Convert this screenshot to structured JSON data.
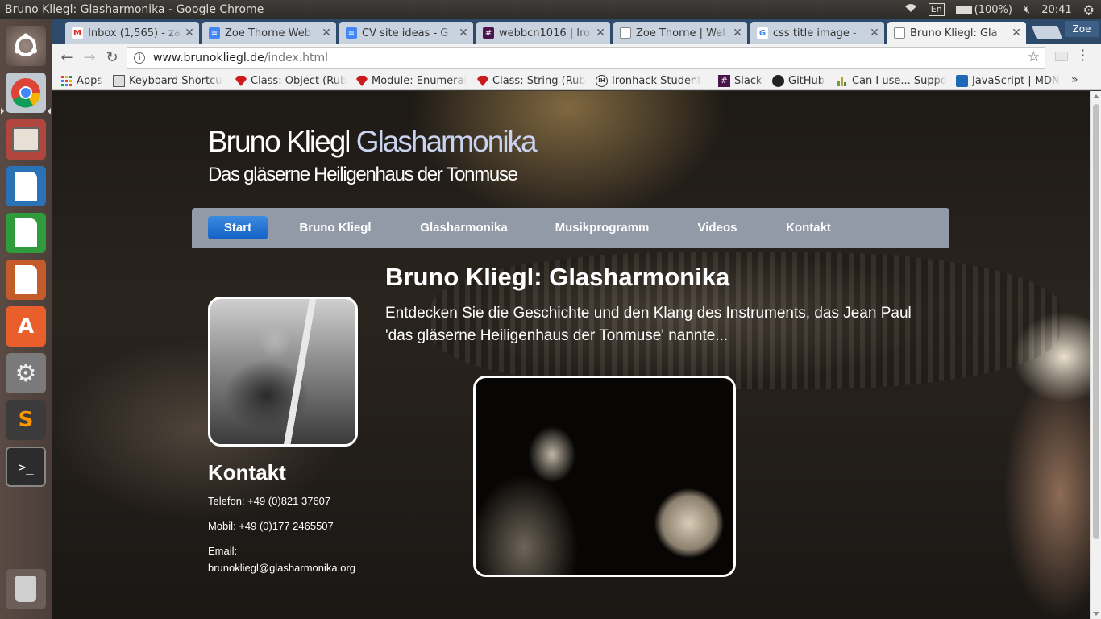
{
  "os_panel": {
    "window_title": "Bruno Kliegl: Glasharmonika - Google Chrome",
    "keyboard": "En",
    "battery": "(100%)",
    "time": "20:41"
  },
  "launcher": {
    "apps": [
      "Ubuntu Dash",
      "Chromium Browser",
      "Files",
      "LibreOffice Writer",
      "LibreOffice Calc",
      "LibreOffice Impress",
      "Ubuntu Software",
      "System Settings",
      "Sublime Text",
      "Terminal",
      "Trash"
    ]
  },
  "browser": {
    "tabs": [
      {
        "label": "Inbox (1,565) - za",
        "icon": "gmail-icon"
      },
      {
        "label": "Zoe Thorne Web",
        "icon": "docs-icon"
      },
      {
        "label": "CV site ideas - G",
        "icon": "docs-icon"
      },
      {
        "label": "webbcn1016 | Iro",
        "icon": "slack-icon"
      },
      {
        "label": "Zoe Thorne | Wel",
        "icon": "page-icon"
      },
      {
        "label": "css title image -",
        "icon": "google-icon"
      },
      {
        "label": "Bruno Kliegl: Gla",
        "icon": "page-icon"
      }
    ],
    "profile": "Zoe",
    "url_host": "www.brunokliegl.de",
    "url_path": "/index.html",
    "bookmarks": [
      {
        "label": "Apps",
        "icon": "apps-grid-icon"
      },
      {
        "label": "Keyboard Shortcu",
        "icon": "keyboard-icon"
      },
      {
        "label": "Class: Object (Rub",
        "icon": "ruby-icon"
      },
      {
        "label": "Module: Enumeral",
        "icon": "ruby-icon"
      },
      {
        "label": "Class: String (Rub",
        "icon": "ruby-icon"
      },
      {
        "label": "Ironhack Student",
        "icon": "ironhack-icon"
      },
      {
        "label": "Slack",
        "icon": "slack-icon"
      },
      {
        "label": "GitHub",
        "icon": "github-icon"
      },
      {
        "label": "Can I use... Suppo",
        "icon": "caniuse-icon"
      },
      {
        "label": "JavaScript | MDN",
        "icon": "mdn-icon"
      }
    ],
    "bookmarks_more": "»"
  },
  "site": {
    "title_main": "Bruno Kliegl ",
    "title_accent": "Glasharmonika",
    "subtitle": "Das gläserne Heiligenhaus der Tonmuse",
    "nav": [
      "Start",
      "Bruno Kliegl",
      "Glasharmonika",
      "Musikprogramm",
      "Videos",
      "Kontakt"
    ],
    "heading": "Bruno Kliegl: Glasharmonika",
    "intro": "Entdecken Sie die Geschichte und den Klang des Instruments, das Jean Paul 'das gläserne Heiligenhaus der Tonmuse' nannte...",
    "contact": {
      "heading": "Kontakt",
      "phone": "Telefon: +49 (0)821 37607",
      "mobile": "Mobil: +49 (0)177 2465507",
      "email_label": "Email:",
      "email": "brunokliegl@glasharmonika.org"
    }
  },
  "colors": {
    "nav_bg": "#919aa6",
    "nav_active": "#1a6fd6",
    "title_accent": "#c9d3f0",
    "chrome_tabstrip": "#2e4a6b"
  }
}
